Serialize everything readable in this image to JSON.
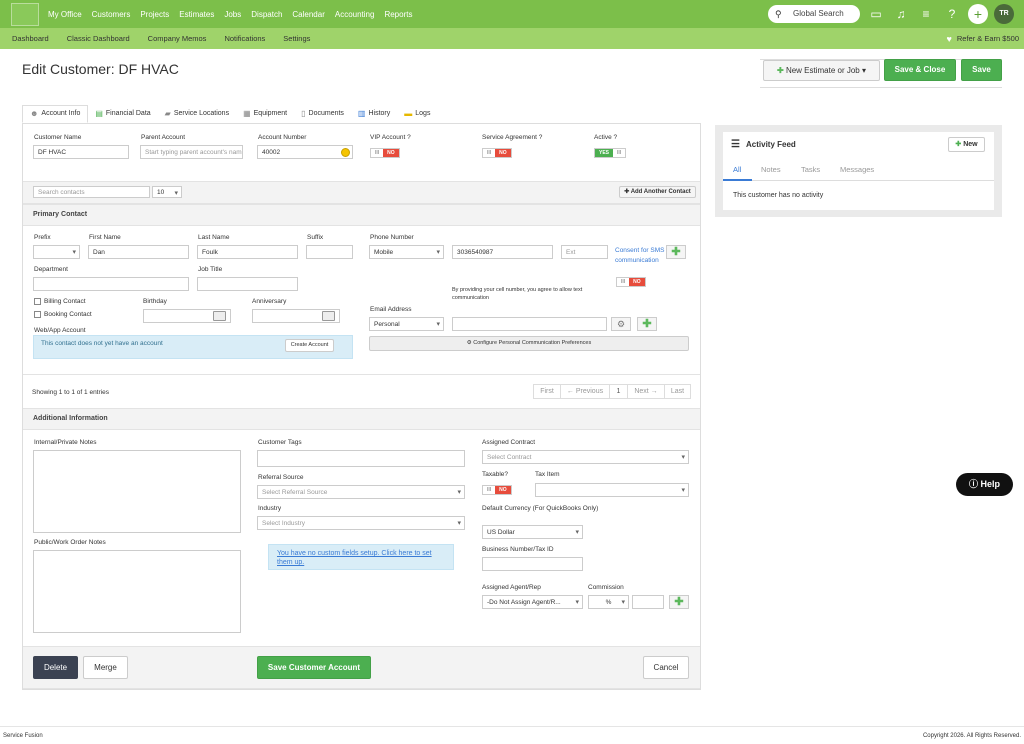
{
  "nav": {
    "items": [
      "My Office",
      "Customers",
      "Projects",
      "Estimates",
      "Jobs",
      "Dispatch",
      "Calendar",
      "Accounting",
      "Reports"
    ],
    "search": "Global Search",
    "avatar": "TR"
  },
  "subnav": {
    "items": [
      "Dashboard",
      "Classic Dashboard",
      "Company Memos",
      "Notifications",
      "Settings"
    ],
    "refer": "Refer & Earn $500"
  },
  "page": {
    "title": "Edit Customer: DF HVAC",
    "new_btn": "New Estimate or Job",
    "save_close": "Save & Close",
    "save": "Save"
  },
  "tabs": [
    "Account Info",
    "Financial Data",
    "Service Locations",
    "Equipment",
    "Documents",
    "History",
    "Logs"
  ],
  "account": {
    "customer_name_label": "Customer Name",
    "customer_name": "DF HVAC",
    "parent_label": "Parent Account",
    "parent_ph": "Start typing parent account's nam",
    "account_number_label": "Account Number",
    "account_number": "40002",
    "vip_label": "VIP Account ?",
    "service_label": "Service Agreement ?",
    "active_label": "Active ?",
    "off": "III",
    "no": "NO",
    "yes": "YES"
  },
  "contacts": {
    "search_ph": "Search contacts",
    "page_size": "10",
    "add_btn": "Add Another Contact",
    "primary": "Primary Contact"
  },
  "contact": {
    "prefix": "Prefix",
    "first": "First Name",
    "first_val": "Dan",
    "last": "Last Name",
    "last_val": "Foulk",
    "suffix": "Suffix",
    "phone": "Phone Number",
    "phone_type": "Mobile",
    "phone_val": "3036540987",
    "ext_ph": "Ext",
    "consent": "Consent for SMS communication",
    "disclaimer": "By providing your cell number, you agree to allow text communication",
    "department": "Department",
    "job_title": "Job Title",
    "billing": "Billing Contact",
    "booking": "Booking Contact",
    "birthday": "Birthday",
    "anniversary": "Anniversary",
    "email": "Email Address",
    "email_type": "Personal",
    "webapp": "Web/App Account",
    "no_account": "This contact does not yet have an account",
    "create_btn": "Create Account",
    "configure": "Configure Personal Communication Preferences"
  },
  "pagination": {
    "showing": "Showing 1 to 1 of 1 entries",
    "first": "First",
    "prev": "← Previous",
    "page": "1",
    "next": "Next →",
    "last": "Last"
  },
  "additional": {
    "title": "Additional Information",
    "internal": "Internal/Private Notes",
    "public": "Public/Work Order Notes",
    "tags": "Customer Tags",
    "referral": "Referral Source",
    "referral_ph": "Select Referral Source",
    "industry": "Industry",
    "industry_ph": "Select Industry",
    "custom_fields": "You have no custom fields setup. Click here to set them up.",
    "contract": "Assigned Contract",
    "contract_ph": "Select Contract",
    "taxable": "Taxable?",
    "tax_item": "Tax Item",
    "currency": "Default Currency (For QuickBooks Only)",
    "currency_val": "US Dollar",
    "business": "Business Number/Tax ID",
    "agent": "Assigned Agent/Rep",
    "agent_val": "-Do Not Assign Agent/R...",
    "commission": "Commission",
    "commission_type": "%"
  },
  "actions": {
    "delete": "Delete",
    "merge": "Merge",
    "save_account": "Save Customer Account",
    "cancel": "Cancel"
  },
  "feed": {
    "title": "Activity Feed",
    "new": "New",
    "tabs": [
      "All",
      "Notes",
      "Tasks",
      "Messages"
    ],
    "empty": "This customer has no activity"
  },
  "help": "Help",
  "footer": {
    "left": "Service Fusion",
    "right": "Copyright 2026. All Rights Reserved."
  },
  "colors": {
    "brand": "#7cbf4a",
    "subnav": "#9fd36a",
    "primary_button": "#4caf50",
    "no_toggle": "#e74c3c"
  }
}
